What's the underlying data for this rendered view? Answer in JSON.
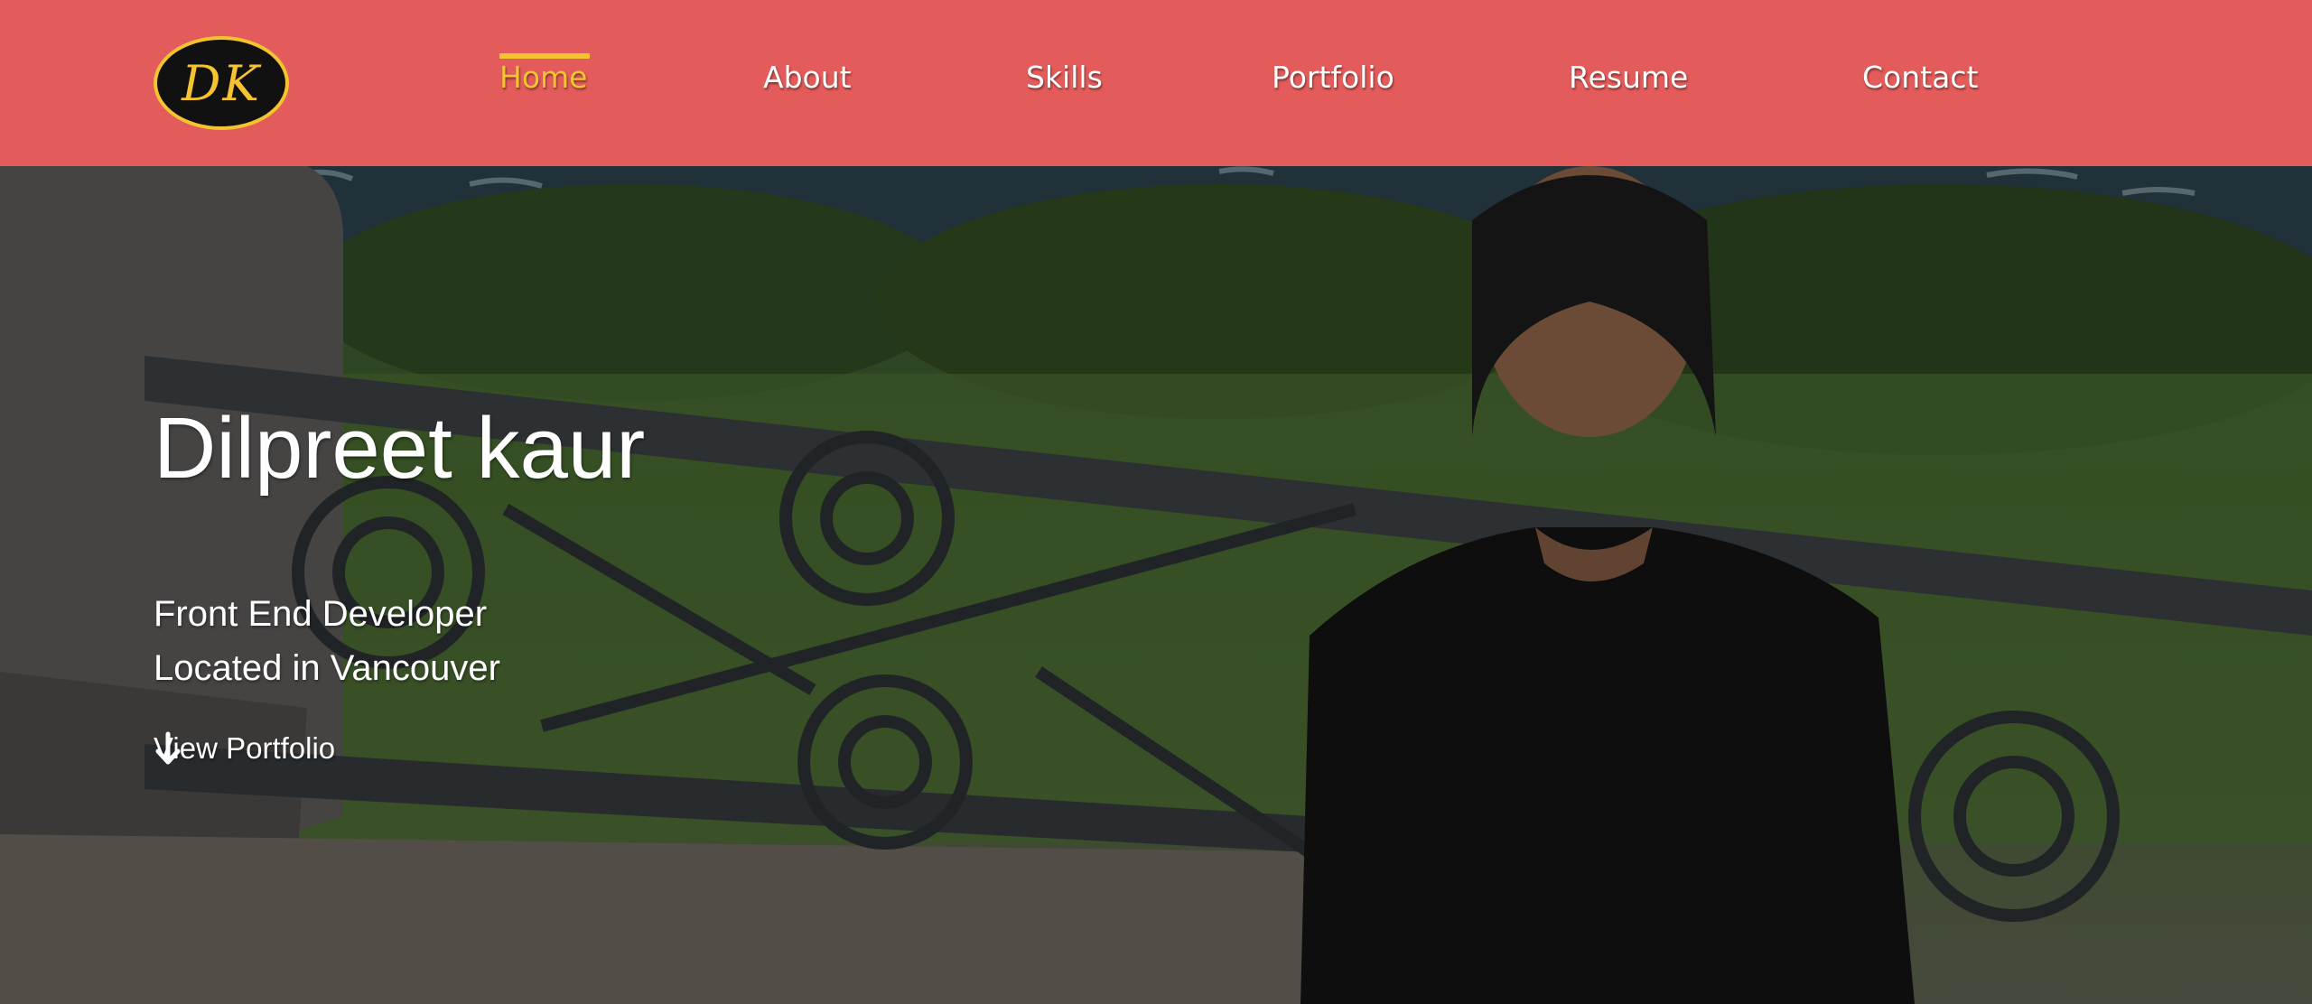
{
  "logo": {
    "initials": "DK",
    "icon": "dk-monogram-logo"
  },
  "nav": {
    "items": [
      {
        "label": "Home",
        "active": true
      },
      {
        "label": "About",
        "active": false
      },
      {
        "label": "Skills",
        "active": false
      },
      {
        "label": "Portfolio",
        "active": false
      },
      {
        "label": "Resume",
        "active": false
      },
      {
        "label": "Contact",
        "active": false
      }
    ]
  },
  "hero": {
    "name": "Dilpreet kaur",
    "title_line": "Front End Developer",
    "location_line": "Located in Vancouver",
    "cta_label": "View Portfolio",
    "cta_icon": "arrow-down-icon",
    "background": "photo of woman in black top by iron railing with greenery and water"
  },
  "colors": {
    "header_bg": "#e35b5a",
    "accent": "#f4c430",
    "text": "#ffffff"
  }
}
